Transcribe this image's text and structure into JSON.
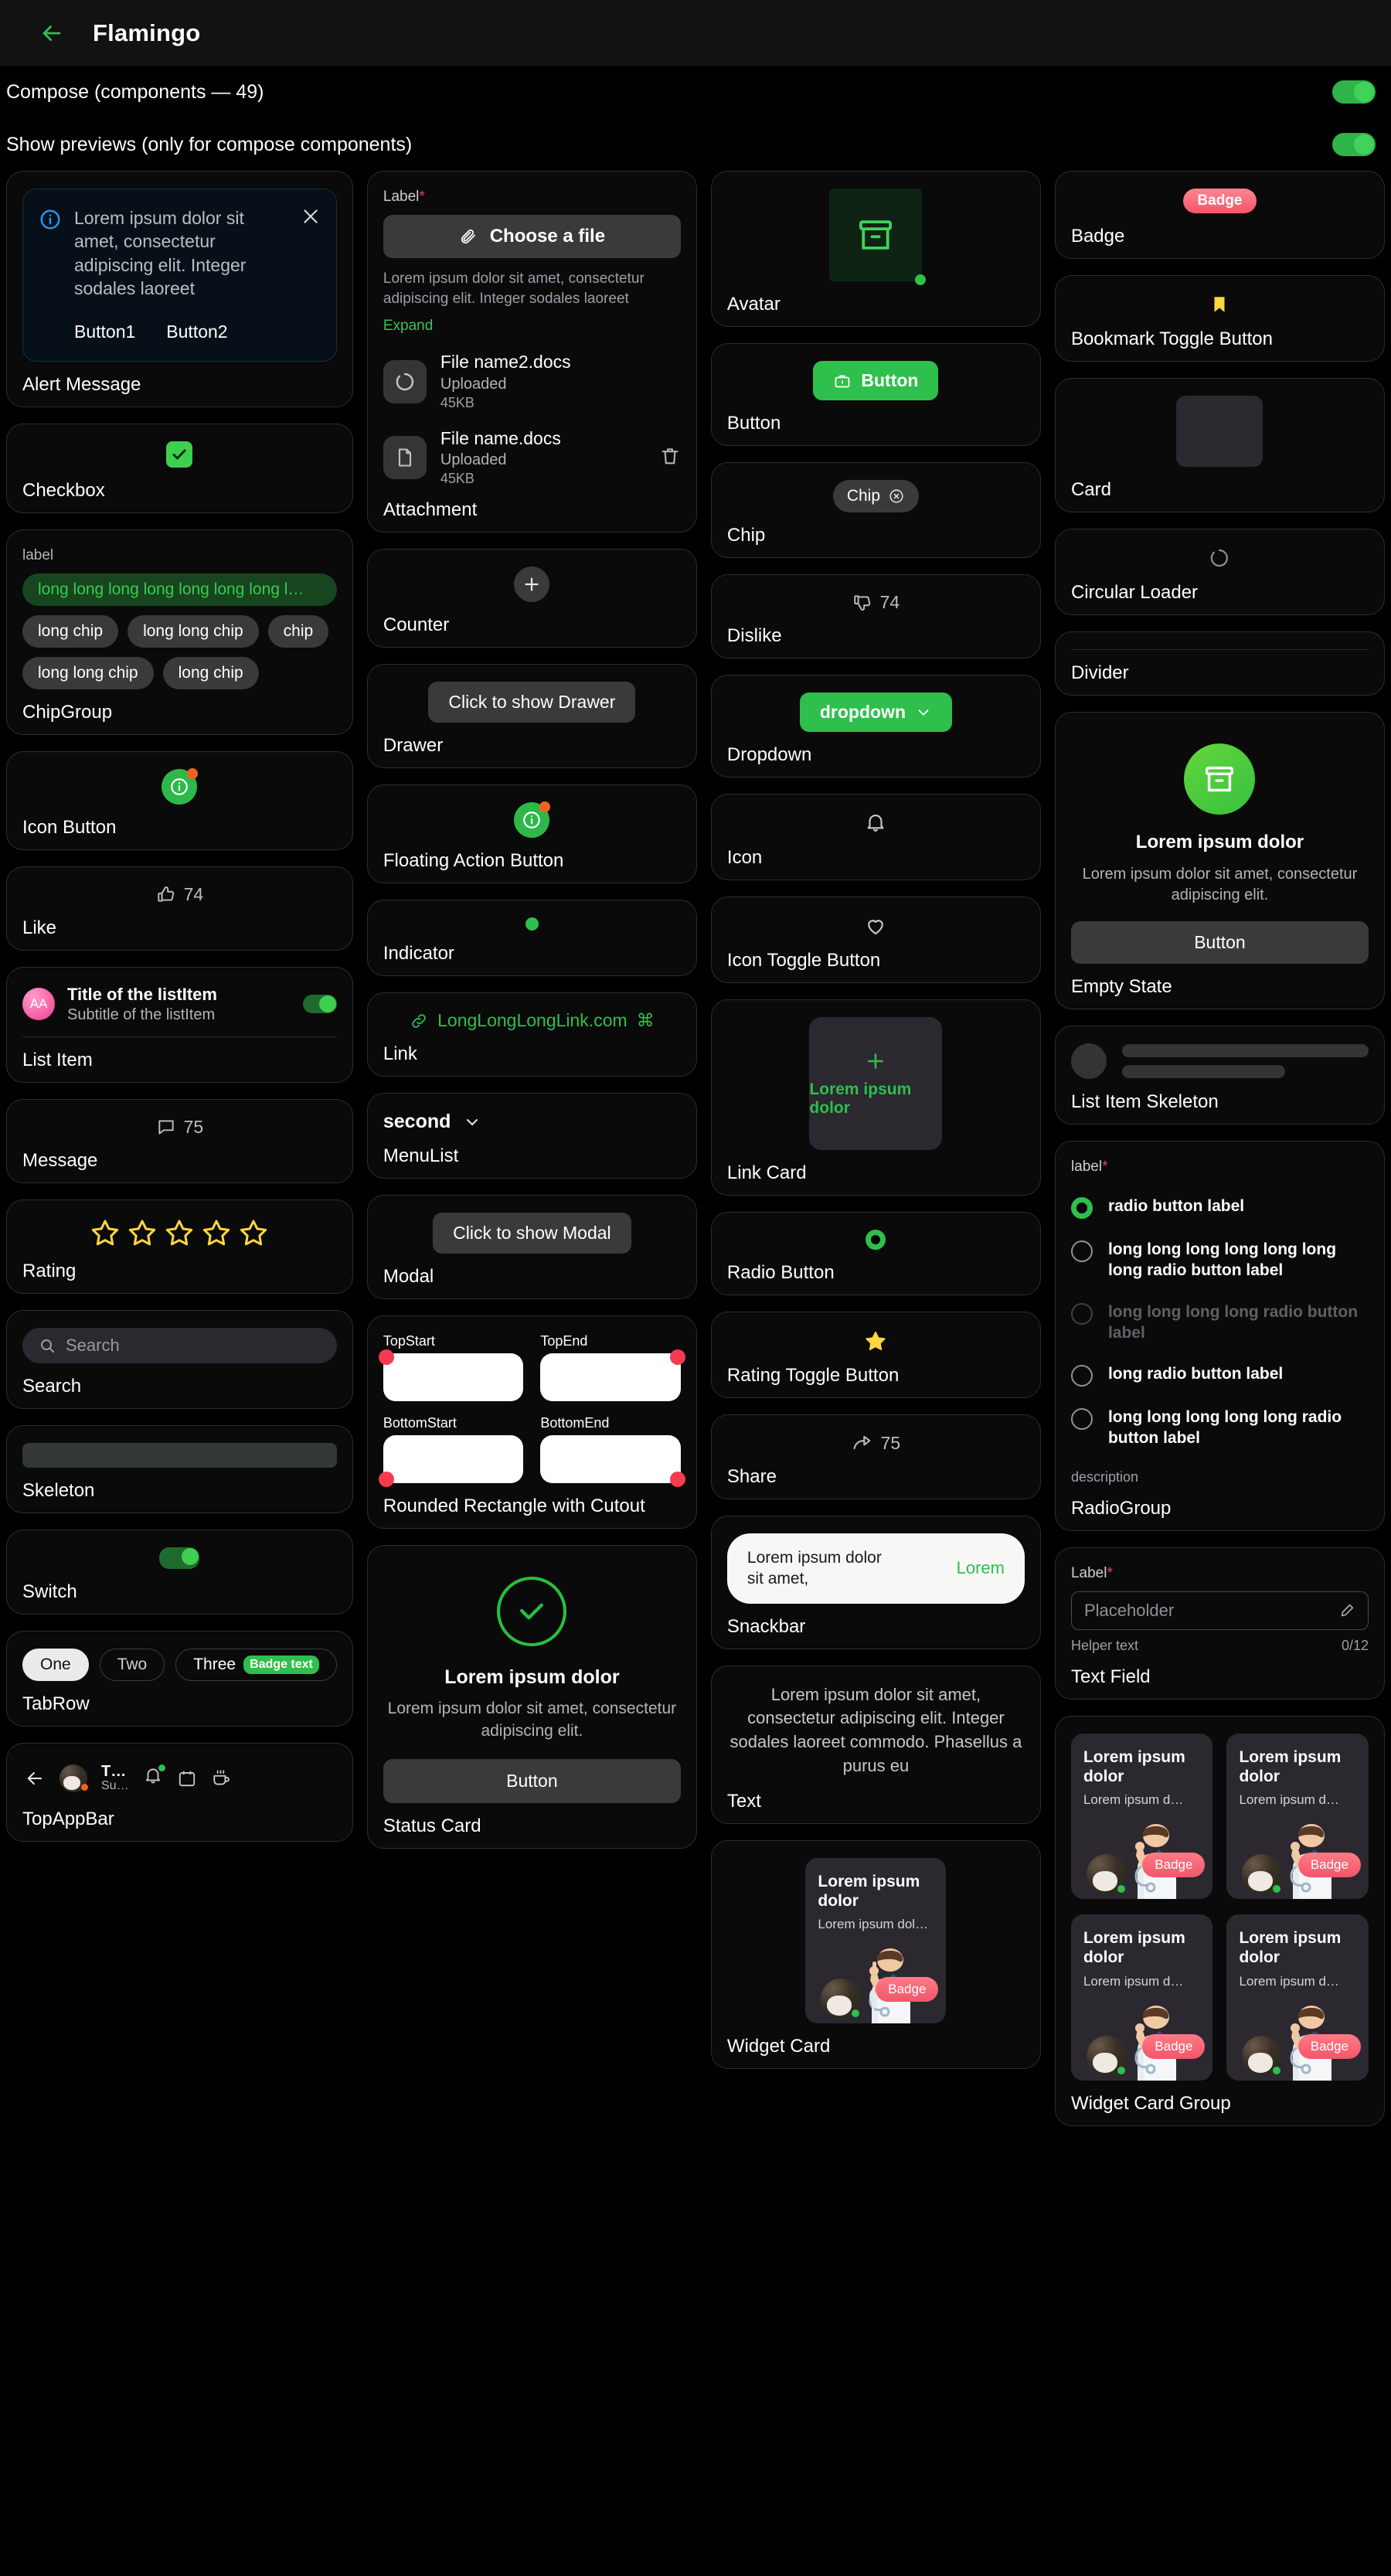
{
  "appbar": {
    "title": "Flamingo",
    "back_icon": "arrow-left-icon"
  },
  "settings": {
    "compose_row": {
      "label": "Compose (components — 49)",
      "enabled": true
    },
    "previews_row": {
      "label": "Show previews (only for compose components)",
      "enabled": true
    }
  },
  "colors": {
    "accent_green": "#2fbf4c",
    "badge_pink": "#f2566a",
    "info_blue": "#2196f3",
    "star_yellow": "#ffd740",
    "orange_dot": "#f4621f",
    "red_dot": "#f53b4f",
    "background": "#000000",
    "card_border": "#2d2d2d"
  },
  "column1": {
    "alert": {
      "card_label": "Alert Message",
      "icon": "info-circle-icon",
      "text": "Lorem ipsum dolor sit amet, consectetur adipiscing elit. Integer sodales laoreet",
      "button1": "Button1",
      "button2": "Button2",
      "close_icon": "close-icon"
    },
    "checkbox": {
      "card_label": "Checkbox",
      "checked": true,
      "icon": "check-icon"
    },
    "chipgroup": {
      "card_label": "ChipGroup",
      "label": "label",
      "selected_chip": "long long long long long long long l…",
      "chips": [
        "long chip",
        "long long chip",
        "chip",
        "long long chip",
        "long chip"
      ]
    },
    "icon_button": {
      "card_label": "Icon Button",
      "icon": "info-circle-icon",
      "has_dot": true
    },
    "like": {
      "card_label": "Like",
      "icon": "thumbs-up-icon",
      "count": "74"
    },
    "list_item": {
      "card_label": "List Item",
      "avatar_initials": "AA",
      "title": "Title of the listItem",
      "subtitle": "Subtitle of the listItem",
      "switch_on": true
    },
    "message": {
      "card_label": "Message",
      "icon": "comment-icon",
      "count": "75"
    },
    "rating": {
      "card_label": "Rating",
      "stars": 5,
      "filled": 0
    },
    "search": {
      "card_label": "Search",
      "placeholder": "Search",
      "value": "",
      "icon": "search-icon"
    },
    "skeleton": {
      "card_label": "Skeleton"
    },
    "switch": {
      "card_label": "Switch",
      "on": true
    },
    "tabrow": {
      "card_label": "TabRow",
      "tabs": [
        "One",
        "Two",
        "Three"
      ],
      "active": "One",
      "badge_text": "Badge text"
    },
    "topappbar": {
      "card_label": "TopAppBar",
      "back_icon": "arrow-left-icon",
      "avatar": "dog-avatar",
      "title": "T…",
      "subtitle": "Su…",
      "icons": [
        "bell-icon",
        "calendar-icon",
        "coffee-icon"
      ],
      "bell_has_dot": true
    }
  },
  "column2": {
    "attachment": {
      "card_label": "Attachment",
      "label": "Label",
      "required": "*",
      "choose_button": "Choose a file",
      "attach_icon": "paperclip-icon",
      "helper": "Lorem ipsum dolor sit amet, consectetur adipiscing elit. Integer sodales laoreet",
      "expand": "Expand",
      "files": [
        {
          "name": "File name2.docs",
          "status": "Uploaded",
          "size": "45KB",
          "icon": "spinner-icon",
          "has_delete": false
        },
        {
          "name": "File name.docs",
          "status": "Uploaded",
          "size": "45KB",
          "icon": "document-icon",
          "has_delete": true,
          "delete_icon": "trash-icon"
        }
      ]
    },
    "counter": {
      "card_label": "Counter",
      "icon": "plus-icon"
    },
    "drawer": {
      "card_label": "Drawer",
      "button": "Click to show Drawer"
    },
    "fab": {
      "card_label": "Floating Action Button",
      "icon": "info-circle-icon",
      "has_dot": true
    },
    "indicator": {
      "card_label": "Indicator"
    },
    "link": {
      "card_label": "Link",
      "text": "LongLongLongLink.com",
      "icon": "link-icon",
      "trailing_icon": "command-icon"
    },
    "menulist": {
      "card_label": "MenuList",
      "selected": "second",
      "icon": "chevron-down-icon"
    },
    "modal": {
      "card_label": "Modal",
      "button": "Click to show Modal"
    },
    "rounded_rect": {
      "card_label": "Rounded Rectangle with Cutout",
      "cells": [
        "TopStart",
        "TopEnd",
        "BottomStart",
        "BottomEnd"
      ]
    },
    "status_card": {
      "card_label": "Status Card",
      "icon": "check-circle-icon",
      "title": "Lorem ipsum dolor",
      "subtitle": "Lorem ipsum dolor sit amet, consectetur adipiscing elit.",
      "button": "Button"
    }
  },
  "column3": {
    "avatar": {
      "card_label": "Avatar",
      "icon": "archive-icon",
      "has_status_dot": true
    },
    "button": {
      "card_label": "Button",
      "text": "Button",
      "icon": "briefcase-icon"
    },
    "chip": {
      "card_label": "Chip",
      "text": "Chip",
      "close_icon": "close-circle-icon"
    },
    "dislike": {
      "card_label": "Dislike",
      "icon": "thumbs-down-icon",
      "count": "74"
    },
    "dropdown": {
      "card_label": "Dropdown",
      "text": "dropdown",
      "icon": "chevron-down-icon"
    },
    "icon": {
      "card_label": "Icon",
      "icon": "bell-icon"
    },
    "icon_toggle": {
      "card_label": "Icon Toggle Button",
      "icon": "heart-icon"
    },
    "link_card": {
      "card_label": "Link Card",
      "icon": "plus-icon",
      "text": "Lorem ipsum dolor"
    },
    "radio_button": {
      "card_label": "Radio Button",
      "selected": true
    },
    "rating_toggle": {
      "card_label": "Rating Toggle Button",
      "icon": "star-icon",
      "filled": true
    },
    "share": {
      "card_label": "Share",
      "icon": "share-icon",
      "count": "75"
    },
    "snackbar": {
      "card_label": "Snackbar",
      "text": "Lorem ipsum dolor sit amet,",
      "action": "Lorem"
    },
    "text": {
      "card_label": "Text",
      "body": "Lorem ipsum dolor sit amet, consectetur adipiscing elit. Integer sodales laoreet commodo. Phasellus a purus eu"
    },
    "widget_card": {
      "card_label": "Widget Card",
      "title": "Lorem ipsum dolor",
      "subtitle": "Lorem ipsum dolor sit…",
      "badge": "Badge"
    }
  },
  "column4": {
    "badge": {
      "card_label": "Badge",
      "text": "Badge"
    },
    "bookmark": {
      "card_label": "Bookmark Toggle Button",
      "icon": "bookmark-icon",
      "filled": true
    },
    "card": {
      "card_label": "Card"
    },
    "circular_loader": {
      "card_label": "Circular Loader",
      "icon": "spinner-icon"
    },
    "divider": {
      "card_label": "Divider"
    },
    "empty_state": {
      "card_label": "Empty State",
      "icon": "archive-icon",
      "title": "Lorem ipsum dolor",
      "subtitle": "Lorem ipsum dolor sit amet, consectetur adipiscing elit.",
      "button": "Button"
    },
    "list_item_skeleton": {
      "card_label": "List Item Skeleton"
    },
    "radiogroup": {
      "card_label": "RadioGroup",
      "label": "label",
      "required": "*",
      "description": "description",
      "options": [
        {
          "text": "radio button label",
          "selected": true,
          "disabled": false
        },
        {
          "text": "long long long long long long long radio button label",
          "selected": false,
          "disabled": false
        },
        {
          "text": "long long long long radio button label",
          "selected": false,
          "disabled": true
        },
        {
          "text": "long radio button label",
          "selected": false,
          "disabled": false
        },
        {
          "text": "long long long long long radio button label",
          "selected": false,
          "disabled": false
        }
      ]
    },
    "text_field": {
      "card_label": "Text Field",
      "label": "Label",
      "required": "*",
      "placeholder": "Placeholder",
      "value": "",
      "helper": "Helper text",
      "counter": "0/12",
      "trailing_icon": "pen-icon"
    },
    "widget_card_group": {
      "card_label": "Widget Card Group",
      "cards": [
        {
          "title": "Lorem ipsum dolor",
          "subtitle": "Lorem ipsum d…",
          "badge": "Badge"
        },
        {
          "title": "Lorem ipsum dolor",
          "subtitle": "Lorem ipsum d…",
          "badge": "Badge"
        },
        {
          "title": "Lorem ipsum dolor",
          "subtitle": "Lorem ipsum d…",
          "badge": "Badge"
        },
        {
          "title": "Lorem ipsum dolor",
          "subtitle": "Lorem ipsum d…",
          "badge": "Badge"
        }
      ]
    }
  }
}
